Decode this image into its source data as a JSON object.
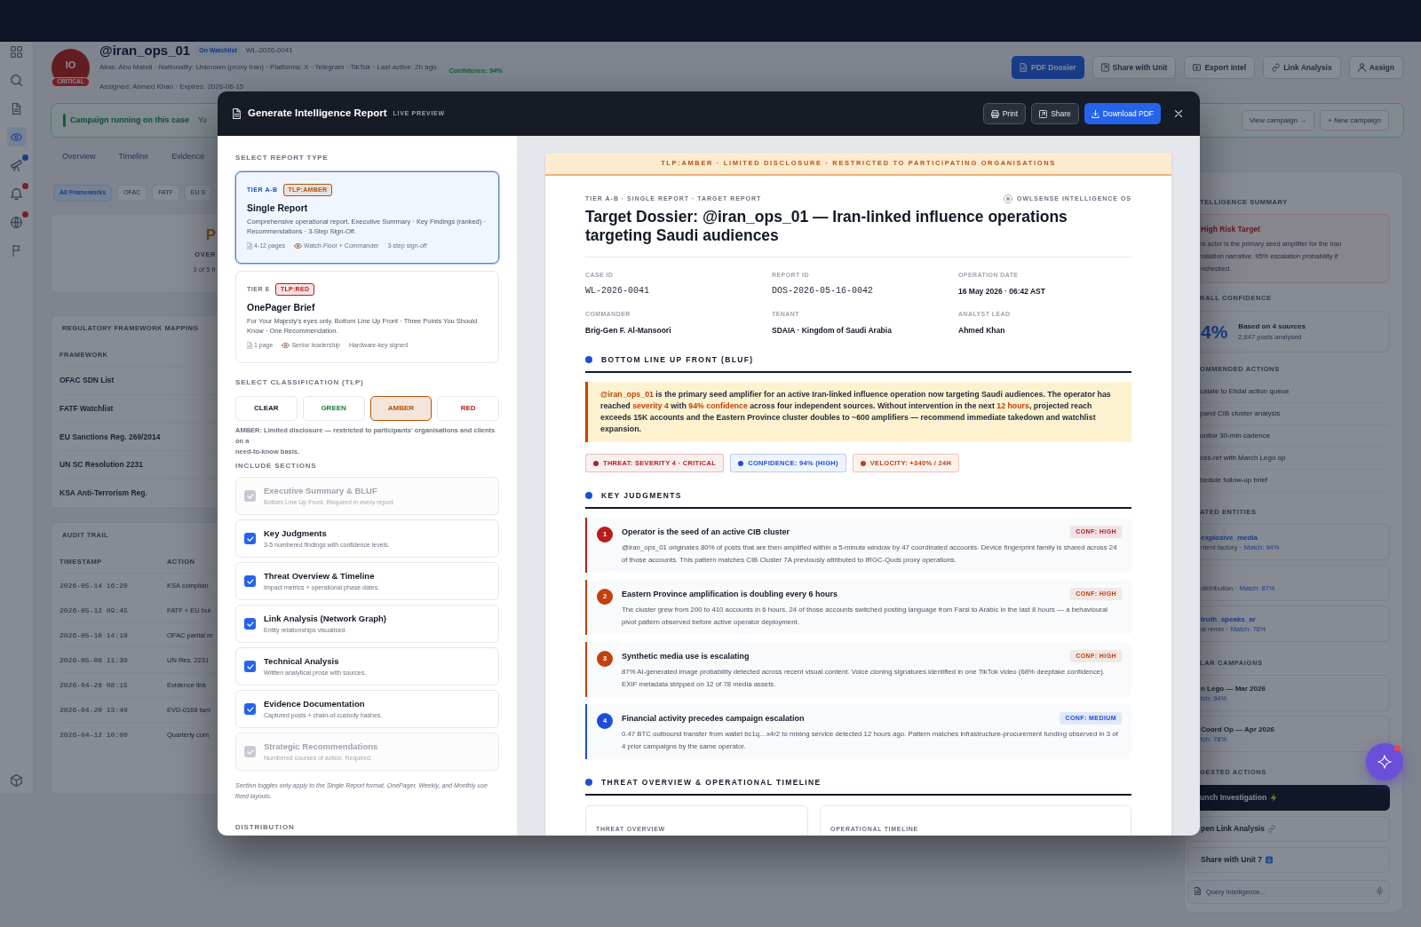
{
  "nav_rail": {
    "items": [
      {
        "selected": false,
        "badge": false
      },
      {
        "selected": false,
        "badge": false
      },
      {
        "selected": false,
        "badge": false
      },
      {
        "selected": true,
        "badge": false
      },
      {
        "selected": false,
        "badge": true,
        "urgent": false
      },
      {
        "selected": false,
        "badge": true,
        "urgent": true
      },
      {
        "selected": false,
        "badge": true,
        "urgent": true
      },
      {
        "selected": false,
        "badge": false
      }
    ]
  },
  "profile": {
    "initials": "IO",
    "risk": "CRITICAL",
    "handle": "@iran_ops_01",
    "status": "On Watchlist",
    "case_id": "WL-2026-0041",
    "details": "Alias: Abu Mahdi · Nationality: Unknown (proxy Iran) · Platforms: X · Telegram · TikTok · Last active: 2h ago",
    "confidence": "Confidence: 94%",
    "assignment": "Assigned: Ahmed Khan · Expires: 2026-06-15"
  },
  "header_actions": [
    {
      "label": "PDF Dossier",
      "primary": true
    },
    {
      "label": "Share with Unit",
      "primary": false
    },
    {
      "label": "Export Intel",
      "primary": false
    },
    {
      "label": "Link Analysis",
      "primary": false
    },
    {
      "label": "Assign",
      "primary": false
    }
  ],
  "campaign_banner": {
    "title": "Campaign running on this case",
    "text": "Yo",
    "actions": [
      "View campaign →",
      "+ New campaign"
    ]
  },
  "tabs": [
    {
      "label": "Overview",
      "selected": false
    },
    {
      "label": "Timeline",
      "selected": false
    },
    {
      "label": "Evidence",
      "selected": false
    }
  ],
  "framework_filters": [
    {
      "label": "All Frameworks",
      "selected": true
    },
    {
      "label": "OFAC",
      "selected": false
    },
    {
      "label": "FATF",
      "selected": false
    },
    {
      "label": "EU S",
      "selected": false
    }
  ],
  "compliance_card": {
    "value": "P",
    "label": "OVER",
    "detail": "3 of 5 fr"
  },
  "framework_mapping": {
    "title": "REGULATORY FRAMEWORK MAPPING",
    "column": "FRAMEWORK",
    "rows": [
      "OFAC SDN List",
      "FATF Watchlist",
      "EU Sanctions Reg. 269/2014",
      "UN SC Resolution 2231",
      "KSA Anti-Terrorism Reg."
    ]
  },
  "audit_trail": {
    "title": "AUDIT TRAIL",
    "columns": [
      "TIMESTAMP",
      "ACTION"
    ],
    "rows": [
      {
        "timestamp": "2026-05-14 16:20",
        "action": "KSA complian"
      },
      {
        "timestamp": "2026-05-12 09:45",
        "action": "FATF + EU bul"
      },
      {
        "timestamp": "2026-05-10 14:10",
        "action": "OFAC partial m"
      },
      {
        "timestamp": "2026-05-08 11:30",
        "action": "UN Res. 2231"
      },
      {
        "timestamp": "2026-04-28 08:15",
        "action": "Evidence link"
      },
      {
        "timestamp": "2026-04-20 13:40",
        "action": "EVD-0168 tam"
      },
      {
        "timestamp": "2026-04-12 10:00",
        "action": "Quarterly com"
      }
    ]
  },
  "intel_panel": {
    "summary_heading": "TELLIGENCE SUMMARY",
    "risk_title": "High Risk Target",
    "risk_lines": [
      "is actor is the primary seed amplifier for the Iran",
      "taliation narrative. 95% escalation probability if",
      "nchecked."
    ],
    "confidence_heading": "RALL CONFIDENCE",
    "confidence_value": "4%",
    "confidence_sources": "Based on 4 sources",
    "confidence_posts": "2,847 posts analysed",
    "actions_heading": "OMMENDED ACTIONS",
    "actions": [
      "calate to Etidal action queue",
      "pand CIB cluster analysis",
      "onitor 30-min cadence",
      "oss-ref with March Lego op",
      "hedule follow-up brief"
    ],
    "entities_heading": "ATED ENTITIES",
    "entities": [
      {
        "name": "explosive_media",
        "detail": "ntent factory ·",
        "match": "Match: 94%"
      },
      {
        "detail": "distribution ·",
        "match": "Match: 87%"
      },
      {
        "name": "truth_speaks_ar",
        "detail": "al remix ·",
        "match": "Match: 78%"
      }
    ],
    "campaigns_heading": "LAR CAMPAIGNS",
    "campaigns": [
      {
        "name": "n Lego — Mar 2026",
        "match": "tch: 94%"
      },
      {
        "name": "Coord Op — Apr 2026",
        "match": "tch: 78%"
      }
    ],
    "suggested_heading": "GESTED ACTIONS",
    "suggested": [
      {
        "label": "unch Investigation",
        "primary": true
      },
      {
        "label": "pen Link Analysis",
        "primary": false
      },
      {
        "label": "Share with Unit 7",
        "primary": false
      }
    ],
    "query": {
      "placeholder": "Query Intelligence..."
    }
  },
  "assistant_button": {
    "alert": true
  },
  "modal": {
    "title": "Generate Intelligence Report",
    "badge": "LIVE PREVIEW",
    "actions": [
      {
        "label": "Print",
        "primary": false
      },
      {
        "label": "Share",
        "primary": false
      },
      {
        "label": "Download PDF",
        "primary": true
      }
    ],
    "report_type_heading": "SELECT REPORT TYPE",
    "report_types": [
      {
        "tier": "TIER A-B",
        "tlp": "TLP:AMBER",
        "color": "#b45309",
        "title": "Single Report",
        "description": "Comprehensive operational report. Executive Summary · Key Findings (ranked) · Recommendations · 3-Step Sign-Off.",
        "meta": [
          {
            "kind": "pages",
            "text": "4-12 pages"
          },
          {
            "kind": "audience",
            "text": "Watch-Floor + Commander"
          },
          {
            "kind": "plain",
            "text": "3-step sign-off"
          }
        ],
        "selected": true
      },
      {
        "tier": "TIER E",
        "tlp": "TLP:RED",
        "color": "#b91c1c",
        "title": "OnePager Brief",
        "description": "For Your Majesty's eyes only. Bottom Line Up Front · Three Points You Should Know · One Recommendation.",
        "meta": [
          {
            "kind": "pages",
            "text": "1 page"
          },
          {
            "kind": "audience",
            "text": "Senior leadership"
          },
          {
            "kind": "plain",
            "text": "Hardware-key signed"
          }
        ],
        "selected": false
      }
    ],
    "classification_heading": "SELECT CLASSIFICATION (TLP)",
    "classifications": [
      {
        "label": "CLEAR",
        "color": "#111827",
        "selected": false
      },
      {
        "label": "GREEN",
        "color": "#15803d",
        "selected": false
      },
      {
        "label": "AMBER",
        "color": "#b45309",
        "selected": true
      },
      {
        "label": "RED",
        "color": "#b91c1c",
        "selected": false
      }
    ],
    "classification_note": "AMBER: Limited disclosure — restricted to participants' organisations and clients on a\nneed-to-know basis.",
    "sections_heading": "INCLUDE SECTIONS",
    "sections": [
      {
        "title": "Executive Summary & BLUF",
        "subtitle": "Bottom Line Up Front. Required in every report.",
        "checked": true,
        "disabled": true
      },
      {
        "title": "Key Judgments",
        "subtitle": "3-5 numbered findings with confidence levels.",
        "checked": true,
        "disabled": false
      },
      {
        "title": "Threat Overview & Timeline",
        "subtitle": "Impact metrics + operational phase dates.",
        "checked": true,
        "disabled": false
      },
      {
        "title": "Link Analysis (Network Graph)",
        "subtitle": "Entity relationships visualised.",
        "checked": true,
        "disabled": false
      },
      {
        "title": "Technical Analysis",
        "subtitle": "Written analytical prose with sources.",
        "checked": true,
        "disabled": false
      },
      {
        "title": "Evidence Documentation",
        "subtitle": "Captured posts + chain-of-custody hashes.",
        "checked": true,
        "disabled": false
      },
      {
        "title": "Strategic Recommendations",
        "subtitle": "Numbered courses of action. Required.",
        "checked": true,
        "disabled": true
      }
    ],
    "sections_note": "Section toggles only apply to the Single Report format. OnePager, Weekly, and Monthly use fixed layouts.",
    "distribution_heading": "DISTRIBUTION",
    "preview": {
      "banner": "TLP:AMBER · LIMITED DISCLOSURE · RESTRICTED TO PARTICIPATING ORGANISATIONS",
      "kicker": "TIER A-B · SINGLE REPORT · TARGET REPORT",
      "brand": "OWLSENSE INTELLIGENCE OS",
      "title": "Target Dossier: @iran_ops_01 — Iran-linked influence operations targeting Saudi audiences",
      "fields": [
        {
          "label": "CASE ID",
          "value": "WL-2026-0041",
          "mono": true
        },
        {
          "label": "REPORT ID",
          "value": "DOS-2026-05-16-0042",
          "mono": true
        },
        {
          "label": "OPERATION DATE",
          "value": "16 May 2026 · 06:42 AST",
          "mono": false
        },
        {
          "label": "COMMANDER",
          "value": "Brig-Gen F. Al-Mansoori",
          "mono": false
        },
        {
          "label": "TENANT",
          "value": "SDAIA · Kingdom of Saudi Arabia",
          "mono": false
        },
        {
          "label": "ANALYST LEAD",
          "value": "Ahmed Khan",
          "mono": false
        }
      ],
      "sections": [
        {
          "kind": "bluf",
          "heading": "BOTTOM LINE UP FRONT (BLUF)",
          "segments": [
            {
              "text": "@iran_ops_01",
              "highlight": true
            },
            {
              "text": " is the primary seed amplifier for an active Iran-linked influence operation now targeting Saudi audiences. The operator has reached ",
              "highlight": false
            },
            {
              "text": "severity 4",
              "highlight": true
            },
            {
              "text": " with ",
              "highlight": false
            },
            {
              "text": "94% confidence",
              "highlight": true
            },
            {
              "text": " across four independent sources. Without intervention in the next ",
              "highlight": false
            },
            {
              "text": "12 hours",
              "highlight": true
            },
            {
              "text": ", projected reach exceeds 15K accounts and the Eastern Province cluster doubles to ~600 amplifiers — recommend immediate takedown and watchlist expansion.",
              "highlight": false
            }
          ],
          "chips": [
            {
              "text": "THREAT: SEVERITY 4 · CRITICAL",
              "color": "#b91c1c"
            },
            {
              "text": "CONFIDENCE: 94% (HIGH)",
              "color": "#1d4ed8"
            },
            {
              "text": "VELOCITY: +340% / 24H",
              "color": "#c2410c"
            }
          ]
        },
        {
          "kind": "judgments",
          "heading": "KEY JUDGMENTS",
          "items": [
            {
              "number": "1",
              "title": "Operator is the seed of an active CIB cluster",
              "confidence": "CONF: HIGH",
              "color": "#b91c1c",
              "text": "@iran_ops_01 originates 80% of posts that are then amplified within a 5-minute window by 47 coordinated accounts. Device fingerprint family is shared across 24 of those accounts. This pattern matches CIB Cluster 7A previously attributed to IRGC-Quds proxy operations."
            },
            {
              "number": "2",
              "title": "Eastern Province amplification is doubling every 6 hours",
              "confidence": "CONF: HIGH",
              "color": "#c2410c",
              "text": "The cluster grew from 200 to 410 accounts in 6 hours. 24 of those accounts switched posting language from Farsi to Arabic in the last 8 hours — a behavioural pivot pattern observed before active operator deployment."
            },
            {
              "number": "3",
              "title": "Synthetic media use is escalating",
              "confidence": "CONF: HIGH",
              "color": "#c2410c",
              "text": "87% AI-generated image probability detected across recent visual content. Voice cloning signatures identified in one TikTok video (68% deepfake confidence). EXIF metadata stripped on 12 of 78 media assets."
            },
            {
              "number": "4",
              "title": "Financial activity precedes campaign escalation",
              "confidence": "CONF: MEDIUM",
              "color": "#1d4ed8",
              "text": "0.47 BTC outbound transfer from wallet bc1q…x4r2 to mixing service detected 12 hours ago. Pattern matches infrastructure-procurement funding observed in 3 of 4 prior campaigns by the same operator."
            }
          ]
        },
        {
          "kind": "panels",
          "heading": "THREAT OVERVIEW & OPERATIONAL TIMELINE",
          "panels": [
            "THREAT OVERVIEW",
            "OPERATIONAL TIMELINE"
          ]
        }
      ]
    }
  }
}
